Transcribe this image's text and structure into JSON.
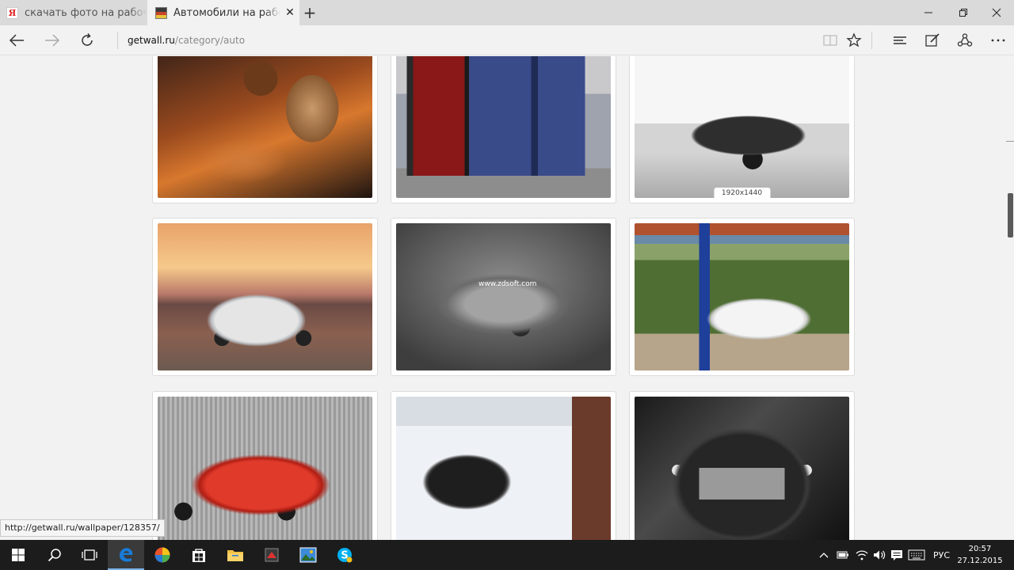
{
  "tabs": [
    {
      "title": "скачать фото на рабочий с",
      "favicon": "yandex-icon",
      "active": false
    },
    {
      "title": "Автомобили на рабочи",
      "favicon": "site-icon",
      "active": true
    }
  ],
  "address": {
    "domain": "getwall.ru",
    "path": "/category/auto"
  },
  "gallery": {
    "images": [
      {
        "subject": "woman in car interior",
        "badge": ""
      },
      {
        "subject": "red and blue truck",
        "badge": ""
      },
      {
        "subject": "black sports car",
        "badge": "1920x1440"
      },
      {
        "subject": "silver Volvo SUV at sunset",
        "badge": ""
      },
      {
        "subject": "grey Honda CR-Z",
        "badge": "",
        "watermark": "www.zdsoft.com"
      },
      {
        "subject": "white Dodge Challenger",
        "badge": ""
      },
      {
        "subject": "red Mercedes sedan",
        "badge": ""
      },
      {
        "subject": "black car in snow",
        "badge": ""
      },
      {
        "subject": "black Maybach",
        "badge": ""
      }
    ]
  },
  "status_url": "http://getwall.ru/wallpaper/128357/",
  "taskbar": {
    "language": "РУС",
    "time": "20:57",
    "date": "27.12.2015"
  },
  "colors": {
    "taskbar": "#1c1c1c",
    "edge_blue": "#1a7bd6",
    "page_bg": "#f2f2f2"
  }
}
